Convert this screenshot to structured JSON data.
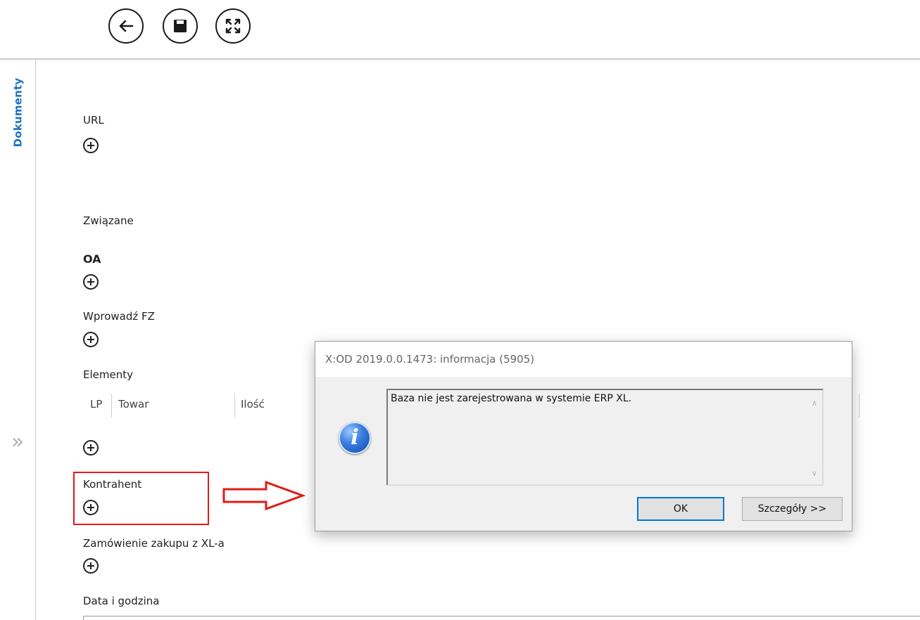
{
  "toolbar": {
    "back_icon": "arrow-left-icon",
    "save_icon": "floppy-disk-icon",
    "fullscreen_icon": "expand-arrows-icon"
  },
  "sidebar": {
    "tab_label": "Dokumenty",
    "expand_glyph": "»"
  },
  "form": {
    "url_label": "URL",
    "related_label": "Związane",
    "oa_label": "OA",
    "enter_fz_label": "Wprowadź FZ",
    "elements_label": "Elementy",
    "columns": [
      "LP",
      "Towar",
      "Ilość"
    ],
    "contractor_label": "Kontrahent",
    "purchase_order_label": "Zamówienie zakupu z XL-a",
    "datetime_label": "Data i godzina"
  },
  "dialog": {
    "title": "X:OD 2019.0.0.1473: informacja (5905)",
    "message": "Baza  nie jest zarejestrowana w systemie ERP XL.",
    "icon": "info-icon",
    "ok_label": "OK",
    "details_label": "Szczegóły >>"
  },
  "colors": {
    "accent": "#1e73be",
    "highlight": "#e11b1b"
  }
}
